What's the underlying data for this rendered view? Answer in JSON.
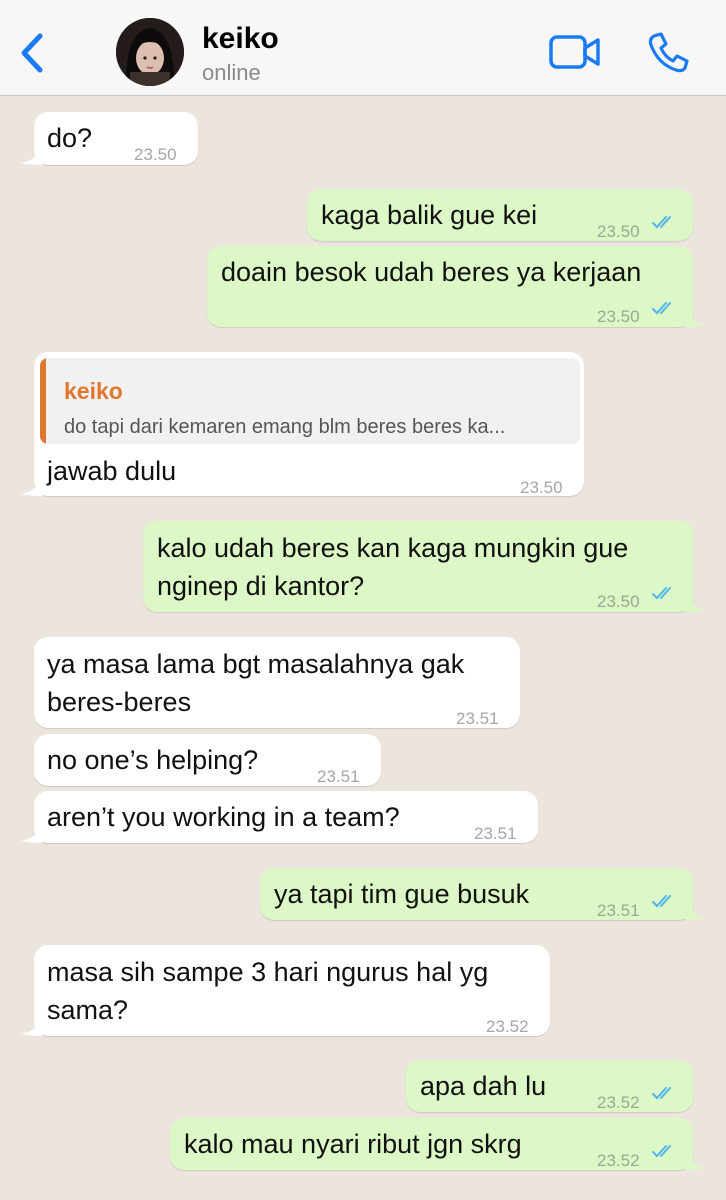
{
  "header": {
    "contact_name": "keiko",
    "status": "online"
  },
  "messages": [
    {
      "direction": "in",
      "text": "do?",
      "time": "23.50"
    },
    {
      "direction": "out",
      "text": "kaga balik gue kei",
      "time": "23.50",
      "read": true
    },
    {
      "direction": "out",
      "text": "doain besok udah beres ya kerjaan",
      "time": "23.50",
      "read": true
    },
    {
      "direction": "in",
      "reply_to": {
        "author": "keiko",
        "text": "do tapi dari kemaren emang blm beres beres ka..."
      },
      "text": "jawab dulu",
      "time": "23.50"
    },
    {
      "direction": "out",
      "lines": [
        "kalo udah beres kan kaga mungkin gue",
        "nginep di kantor?"
      ],
      "time": "23.50",
      "read": true
    },
    {
      "direction": "in",
      "lines": [
        "ya masa lama bgt masalahnya gak",
        "beres-beres"
      ],
      "time": "23.51"
    },
    {
      "direction": "in",
      "text": "no one’s helping?",
      "time": "23.51"
    },
    {
      "direction": "in",
      "text": "aren’t you working in a team?",
      "time": "23.51"
    },
    {
      "direction": "out",
      "text": "ya tapi tim gue busuk",
      "time": "23.51",
      "read": true
    },
    {
      "direction": "in",
      "lines": [
        "masa sih sampe 3 hari ngurus hal yg",
        "sama?"
      ],
      "time": "23.52"
    },
    {
      "direction": "out",
      "text": "apa dah lu",
      "time": "23.52",
      "read": true
    },
    {
      "direction": "out",
      "text": "kalo mau nyari ribut jgn skrg",
      "time": "23.52",
      "read": true
    }
  ],
  "colors": {
    "accent": "#1B7BF5",
    "incoming_bubble": "#FFFFFF",
    "outgoing_bubble": "#DCF8C6",
    "chat_background": "#ECE5DD",
    "read_ticks": "#4FB6EC",
    "reply_author": "#E0772E"
  },
  "icons": {
    "back": "chevron-left-icon",
    "video": "video-camera-icon",
    "call": "phone-icon",
    "read": "double-check-icon"
  }
}
